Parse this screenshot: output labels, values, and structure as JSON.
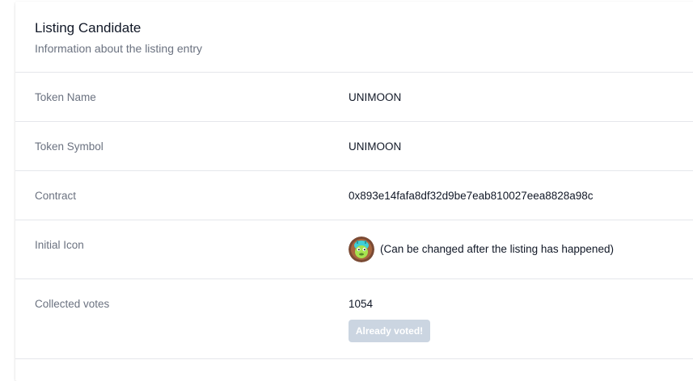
{
  "header": {
    "title": "Listing Candidate",
    "subtitle": "Information about the listing entry"
  },
  "fields": {
    "token_name": {
      "label": "Token Name",
      "value": "UNIMOON"
    },
    "token_symbol": {
      "label": "Token Symbol",
      "value": "UNIMOON"
    },
    "contract": {
      "label": "Contract",
      "value": "0x893e14fafa8df32d9be7eab810027eea8828a98c"
    },
    "initial_icon": {
      "label": "Initial Icon",
      "icon": "unimoon-token-icon",
      "note": "(Can be changed after the listing has happened)"
    },
    "collected_votes": {
      "label": "Collected votes",
      "value": "1054",
      "button_label": "Already voted!"
    }
  },
  "colors": {
    "title": "#111827",
    "label": "#6b7280",
    "divider": "#e5e7eb",
    "button_disabled": "#cbd5e1"
  }
}
